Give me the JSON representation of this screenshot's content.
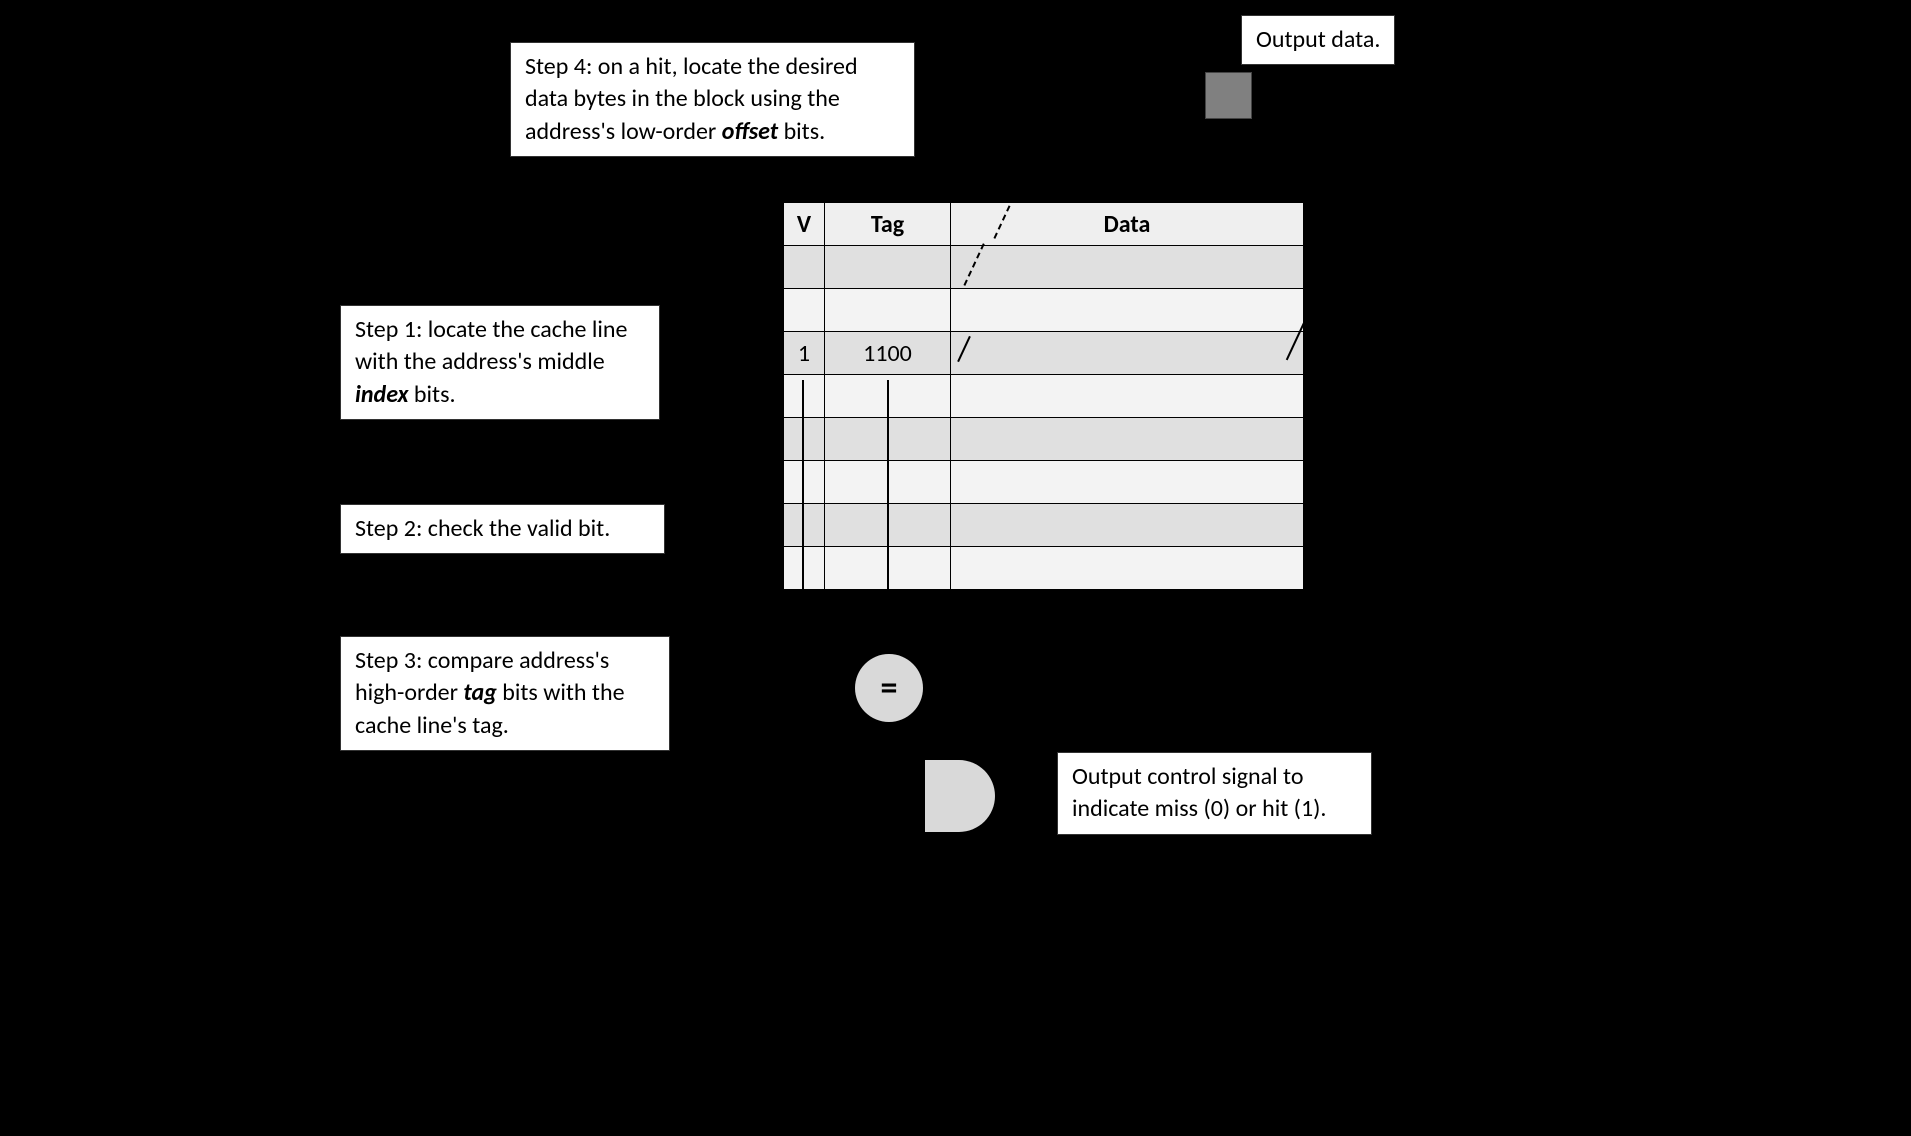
{
  "steps": {
    "step4_pre": "Step 4: on a hit, locate the desired data bytes in the block using the address's low-order ",
    "step4_bold": "offset",
    "step4_post": " bits.",
    "step1_pre": "Step 1: locate the cache line with the address's middle ",
    "step1_bold": "index",
    "step1_post": " bits.",
    "step2": "Step 2: check the valid bit.",
    "step3_pre": "Step 3: compare address's high-order ",
    "step3_bold": "tag",
    "step3_post": " bits with the cache line's tag."
  },
  "output_data": "Output data.",
  "output_signal": "Output control signal to indicate miss (0) or hit (1).",
  "table": {
    "headers": {
      "v": "V",
      "tag": "Tag",
      "data": "Data"
    },
    "rows": [
      {
        "v": "",
        "tag": "",
        "data": ""
      },
      {
        "v": "",
        "tag": "",
        "data": ""
      },
      {
        "v": "1",
        "tag": "1100",
        "data": ""
      },
      {
        "v": "",
        "tag": "",
        "data": ""
      },
      {
        "v": "",
        "tag": "",
        "data": ""
      },
      {
        "v": "",
        "tag": "",
        "data": ""
      },
      {
        "v": "",
        "tag": "",
        "data": ""
      },
      {
        "v": "",
        "tag": "",
        "data": ""
      }
    ],
    "highlight_row": 2
  },
  "comparator": "="
}
